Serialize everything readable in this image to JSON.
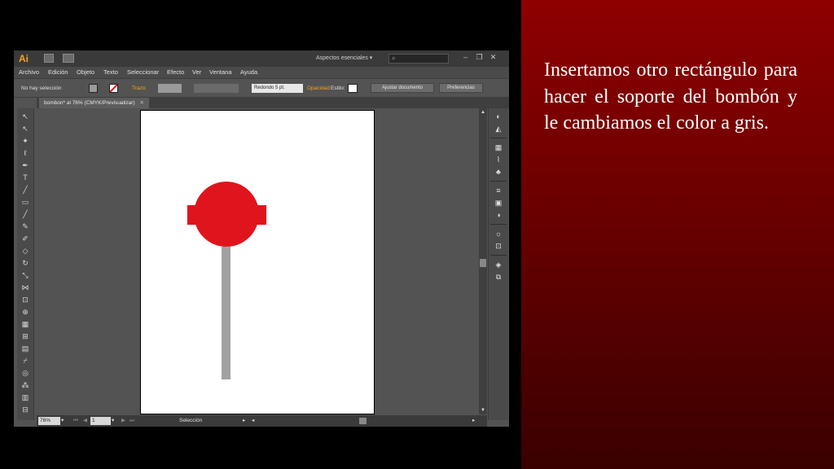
{
  "slide": {
    "text": "Insertamos otro rectángulo para hacer el soporte del bombón y le cambiamos el color a gris."
  },
  "app": {
    "logo": "Ai",
    "workspace": "Aspectos esenciales",
    "workspace_arrow": "▾",
    "search_icon": "⌕",
    "window_controls": [
      "–",
      "❐",
      "✕"
    ]
  },
  "menu": [
    "Archivo",
    "Edición",
    "Objeto",
    "Texto",
    "Seleccionar",
    "Efecto",
    "Ver",
    "Ventana",
    "Ayuda"
  ],
  "control_bar": {
    "selection": "No hay selección",
    "stroke_label": "Trazo:",
    "brush": "Redondo 5 pt.",
    "opacity_label": "Opacidad",
    "style_label": "Estilo:",
    "doc_setup": "Ajustar documento",
    "preferences": "Preferencias",
    "fill_color": "#9a9a9a"
  },
  "document": {
    "tab_title": "bombon* al 76% (CMYK/Previsualizar)",
    "tab_close": "✕"
  },
  "artwork": {
    "candy_color": "#e0141c",
    "stick_color": "#a1a1a1"
  },
  "status": {
    "zoom": "76%",
    "page": "1",
    "tool": "Selección"
  }
}
